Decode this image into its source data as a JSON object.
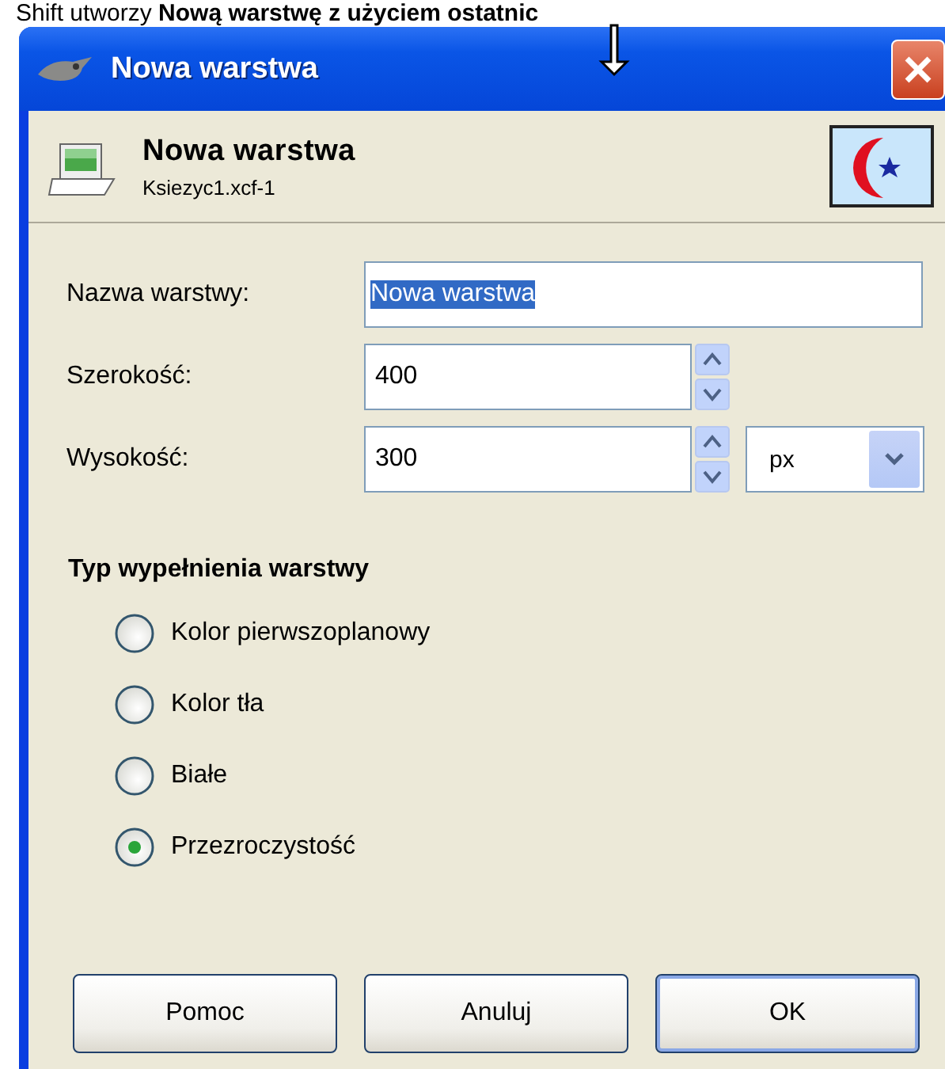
{
  "caption": "Shift utworzy **Nową warstwę z użyciem ostatnic**",
  "window": {
    "title": "Nowa warstwa"
  },
  "header": {
    "title": "Nowa warstwa",
    "subtitle": "Ksiezyc1.xcf-1"
  },
  "name_field": {
    "label": "Nazwa warstwy:",
    "value": "Nowa warstwa",
    "text_selected": true
  },
  "width_field": {
    "label": "Szerokość:",
    "value": "400"
  },
  "height_field": {
    "label": "Wysokość:",
    "value": "300"
  },
  "unit": {
    "value": "px"
  },
  "fill_type": {
    "title": "Typ wypełnienia warstwy",
    "options": [
      {
        "label": "Kolor pierwszoplanowy",
        "selected": false
      },
      {
        "label": "Kolor tła",
        "selected": false
      },
      {
        "label": "Białe",
        "selected": false
      },
      {
        "label": "Przezroczystość",
        "selected": true
      }
    ]
  },
  "buttons": [
    {
      "label": "Pomoc",
      "default": false
    },
    {
      "label": "Anuluj",
      "default": false
    },
    {
      "label": "OK",
      "default": true
    }
  ]
}
